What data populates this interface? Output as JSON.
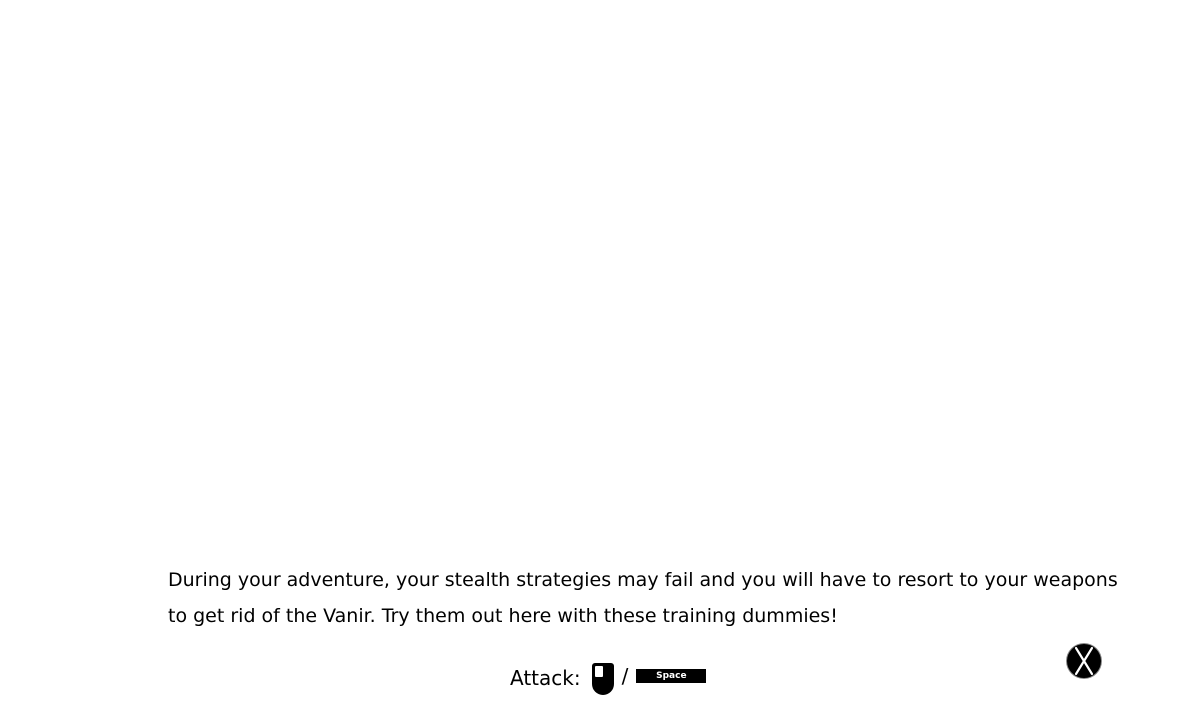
{
  "tutorial": {
    "lines": [
      "During your adventure, your stealth strategies may fail and you will have to resort to your weapons",
      "to get rid of the Vanir. Try them out here with these training dummies!"
    ]
  },
  "controls": {
    "attack_label": "Attack:",
    "separator": "/",
    "space_key_label": "Space",
    "mouse_icon": "mouse-left-click-icon"
  },
  "close": {
    "icon": "close-x-icon"
  },
  "colors": {
    "background": "#ffffff",
    "text": "#000000",
    "key_fill": "#000000",
    "key_text": "#ffffff"
  }
}
